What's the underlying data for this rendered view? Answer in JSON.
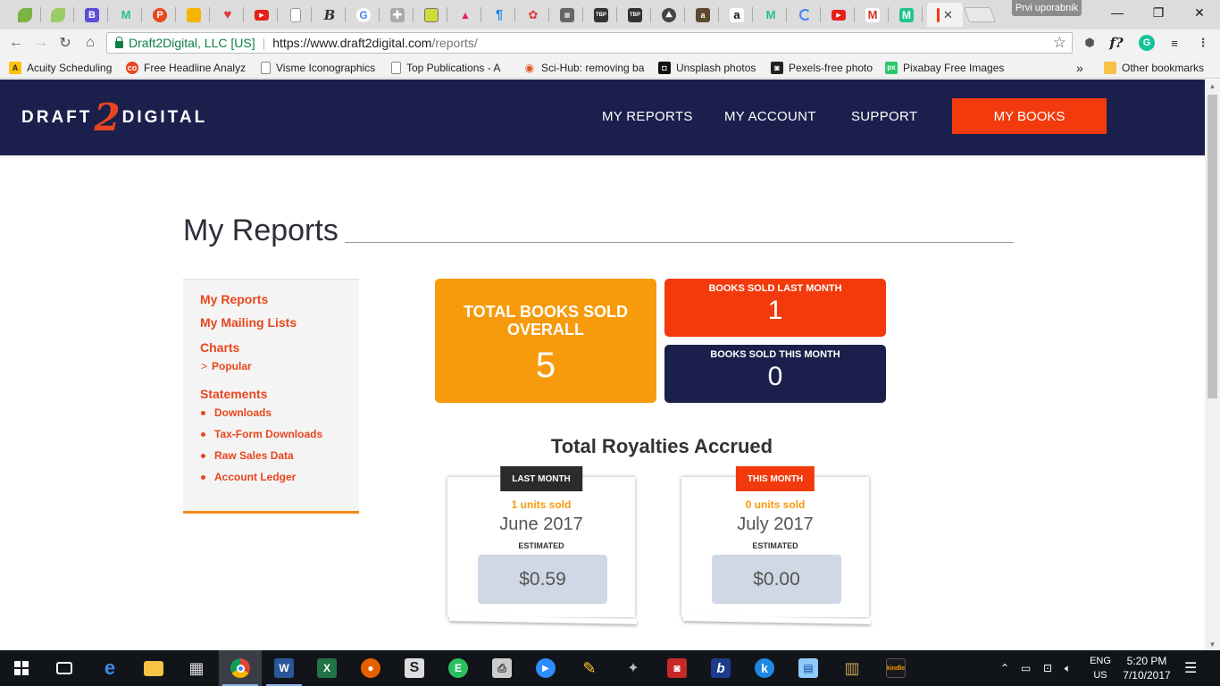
{
  "browser": {
    "profile_name": "Prvi uporabnik",
    "url": {
      "secure_label": "Draft2Digital, LLC [US]",
      "host": "https://www.draft2digital.com",
      "path": "/reports/"
    },
    "bookmarks": [
      {
        "label": "Acuity Scheduling",
        "icon": "acuity-icon",
        "color": "#222222"
      },
      {
        "label": "Free Headline Analyz",
        "icon": "coschedule-icon",
        "color": "#e8461e"
      },
      {
        "label": "Visme Iconographics",
        "icon": "page-icon",
        "color": "#888888"
      },
      {
        "label": "Top Publications - A",
        "icon": "page-icon",
        "color": "#888888"
      },
      {
        "label": "Sci-Hub: removing ba",
        "icon": "scihub-icon",
        "color": "#d9541e"
      },
      {
        "label": "Unsplash photos",
        "icon": "camera-icon",
        "color": "#111111"
      },
      {
        "label": "Pexels-free photo",
        "icon": "pexels-icon",
        "color": "#222222"
      },
      {
        "label": "Pixabay Free Images",
        "icon": "pixabay-icon",
        "color": "#2ec66d"
      }
    ],
    "bookmarks_overflow": "»",
    "other_bookmarks": "Other bookmarks"
  },
  "site": {
    "logo_left": "DRAFT",
    "logo_mark": "2",
    "logo_right": "DIGITAL",
    "nav": {
      "reports": "MY REPORTS",
      "account": "MY ACCOUNT",
      "support": "SUPPORT",
      "books": "MY BOOKS"
    },
    "page_title": "My Reports",
    "sidebar": {
      "my_reports": "My Reports",
      "mailing_lists": "My Mailing Lists",
      "charts": "Charts",
      "popular": "Popular",
      "popular_chevron": ">",
      "statements": "Statements",
      "statement_items": [
        "Downloads",
        "Tax-Form Downloads",
        "Raw Sales Data",
        "Account Ledger"
      ]
    },
    "stats": {
      "total_label": "TOTAL BOOKS SOLD OVERALL",
      "total_value": "5",
      "last_month_label": "BOOKS SOLD LAST MONTH",
      "last_month_value": "1",
      "this_month_label": "BOOKS SOLD THIS MONTH",
      "this_month_value": "0"
    },
    "royalties": {
      "title": "Total Royalties Accrued",
      "cards": [
        {
          "badge": "LAST MONTH",
          "badge_color": "#2b2b2b",
          "units": "1 units sold",
          "month": "June 2017",
          "estimated": "ESTIMATED",
          "amount": "$0.59"
        },
        {
          "badge": "THIS MONTH",
          "badge_color": "#f23a0c",
          "units": "0 units sold",
          "month": "July 2017",
          "estimated": "ESTIMATED",
          "amount": "$0.00"
        }
      ]
    }
  },
  "taskbar": {
    "language": "ENG",
    "region": "US",
    "time": "5:20 PM",
    "date": "7/10/2017"
  },
  "colors": {
    "navy": "#1b1f4b",
    "orange_red": "#f23a0c",
    "amber": "#f79a0c",
    "link": "#e8461e"
  }
}
